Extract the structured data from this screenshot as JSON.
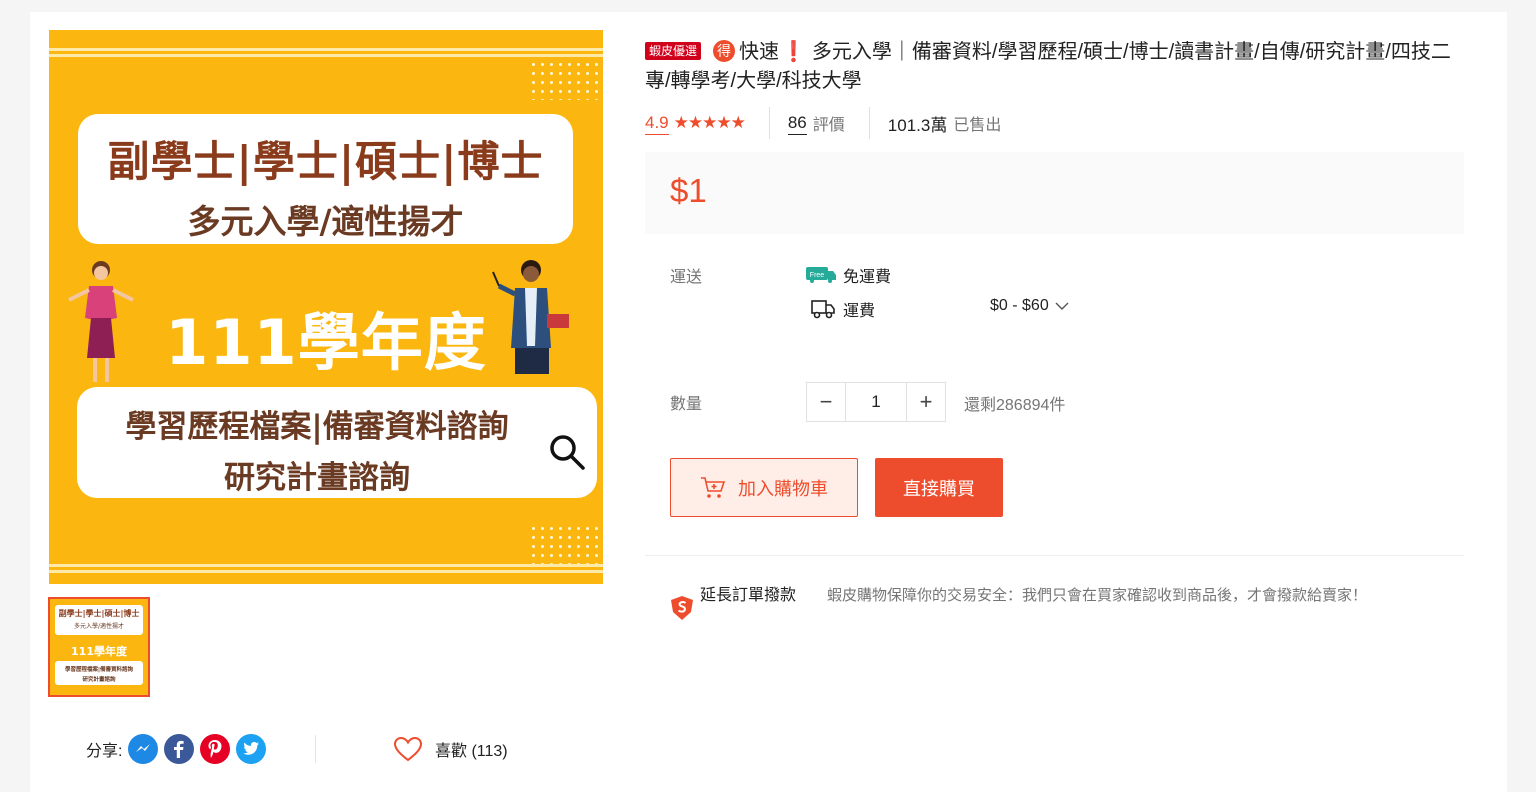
{
  "product": {
    "image": {
      "line1": "副學士|學士|碩士|博士",
      "line2": "多元入學/適性揚才",
      "year": "111學年度",
      "line3": "學習歷程檔案|備審資料諮詢",
      "line4": "研究計畫諮詢"
    },
    "badge": "蝦皮優選",
    "de_icon": "得",
    "title_prefix": "快速",
    "title_excl": "❗",
    "title": "多元入學｜備審資料/學習歷程/碩士/博士/讀書計畫/自傳/研究計畫/四技二專/轉學考/大學/科技大學",
    "rating": "4.9",
    "stars": "★★★★★",
    "review_count": "86",
    "review_label": "評價",
    "sold_count": "101.3萬",
    "sold_label": "已售出",
    "price": "$1"
  },
  "shipping": {
    "label": "運送",
    "free_tag": "Free",
    "free_text": "免運費",
    "fee_label": "運費",
    "fee_range": "$0 - $60"
  },
  "quantity": {
    "label": "數量",
    "minus": "−",
    "value": "1",
    "plus": "+",
    "stock": "還剩286894件"
  },
  "actions": {
    "add_to_cart": "加入購物車",
    "buy_now": "直接購買"
  },
  "guarantee": {
    "title": "延長訂單撥款",
    "text": "蝦皮購物保障你的交易安全：我們只會在買家確認收到商品後，才會撥款給賣家！"
  },
  "share": {
    "label": "分享:",
    "icons": [
      "messenger-icon",
      "facebook-icon",
      "pinterest-icon",
      "twitter-icon"
    ]
  },
  "like": {
    "label": "喜歡 (113)"
  },
  "colors": {
    "accent": "#ee4d2d",
    "image_bg": "#fbb70f"
  }
}
